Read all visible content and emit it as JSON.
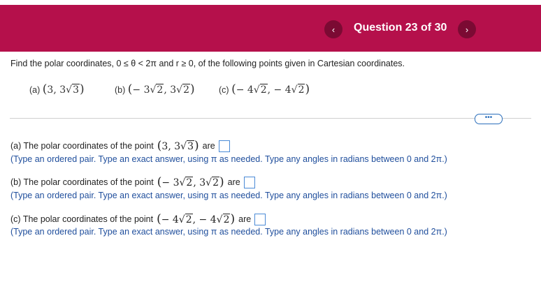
{
  "header": {
    "prev_icon": "‹",
    "next_icon": "›",
    "title": "Question 23 of 30"
  },
  "prompt": "Find the polar coordinates, 0 ≤ θ < 2π and r ≥ 0, of the following points given in Cartesian coordinates.",
  "parts": {
    "a": {
      "label": "(a)",
      "x": "3",
      "y_coef": "3",
      "y_rad": "3"
    },
    "b": {
      "label": "(b)",
      "x_coef": "− 3",
      "x_rad": "2",
      "y_coef": "3",
      "y_rad": "2"
    },
    "c": {
      "label": "(c)",
      "x_coef": "− 4",
      "x_rad": "2",
      "y_coef": "− 4",
      "y_rad": "2"
    }
  },
  "more_label": "•••",
  "answers": {
    "a": {
      "lead": "(a) The polar coordinates of the point",
      "are": "are",
      "hint": "(Type an ordered pair. Type an exact answer, using π as needed. Type any angles in radians between 0 and 2π.)"
    },
    "b": {
      "lead": "(b) The polar coordinates of the point",
      "are": "are",
      "hint": "(Type an ordered pair. Type an exact answer, using π as needed. Type any angles in radians between 0 and 2π.)"
    },
    "c": {
      "lead": "(c) The polar coordinates of the point",
      "are": "are",
      "hint": "(Type an ordered pair. Type an exact answer, using π as needed. Type any angles in radians between 0 and 2π.)"
    }
  },
  "colors": {
    "banner": "#b5104b",
    "nav": "#7b0a33",
    "hint": "#1f4e9c"
  }
}
